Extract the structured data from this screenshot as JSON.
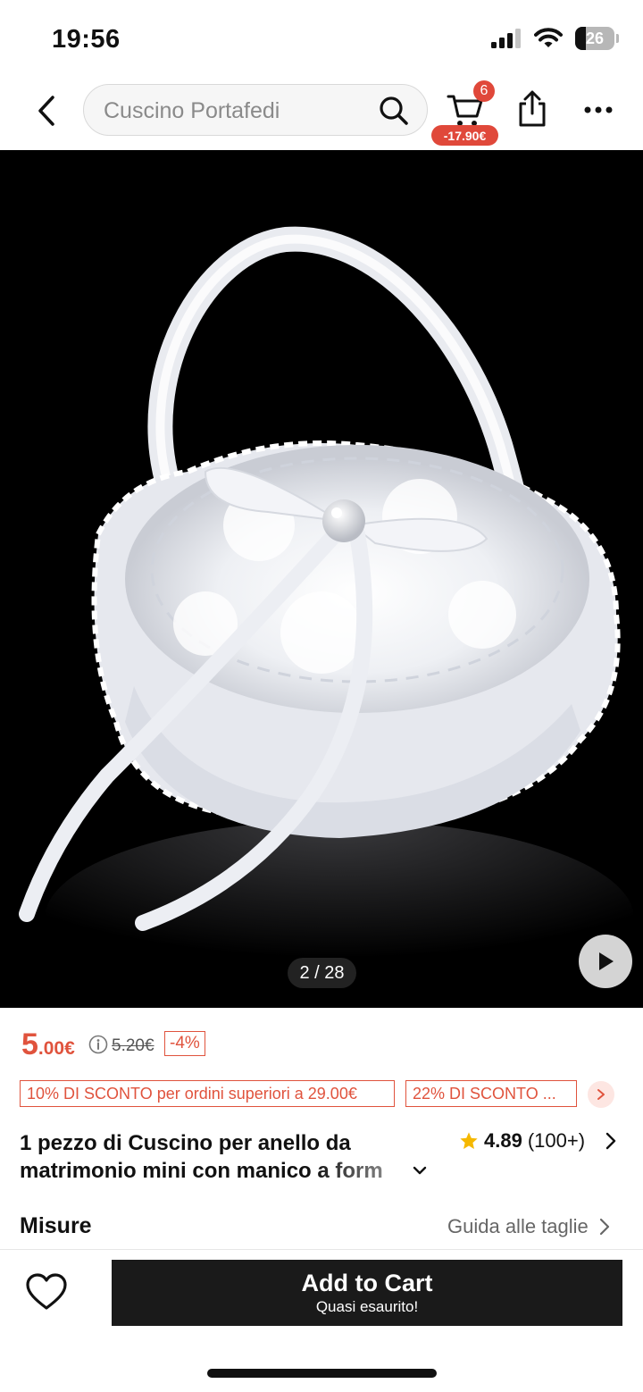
{
  "status_bar": {
    "time": "19:56",
    "battery_level": "26",
    "icons": [
      "cellular-signal-icon",
      "wifi-icon",
      "battery-icon"
    ]
  },
  "nav": {
    "search_placeholder": "Cuscino Portafedi",
    "cart_count": "6",
    "cart_discount": "-17.90€",
    "icons": [
      "back-icon",
      "search-icon",
      "cart-icon",
      "share-icon",
      "more-icon"
    ]
  },
  "gallery": {
    "counter": "2 / 28",
    "current_index": 2,
    "total": 28
  },
  "price": {
    "integer": "5",
    "decimal": ".00€",
    "original": "5.20€",
    "discount": "-4%"
  },
  "coupons": [
    {
      "label": "10% DI SCONTO per ordini superiori a 29.00€"
    },
    {
      "label": "22% DI SCONTO ..."
    }
  ],
  "product": {
    "title_line1": "1 pezzo di Cuscino per anello da",
    "title_line2": "matrimonio mini con manico a form",
    "rating": "4.89",
    "review_count": "(100+)"
  },
  "sizes": {
    "label": "Misure",
    "guide": "Guida alle taglie"
  },
  "actions": {
    "add_to_cart": "Add to Cart",
    "stock_note": "Quasi esaurito!"
  },
  "colors": {
    "accent": "#e0533d",
    "badge": "#e0483a",
    "cta": "#1a1a1a"
  }
}
